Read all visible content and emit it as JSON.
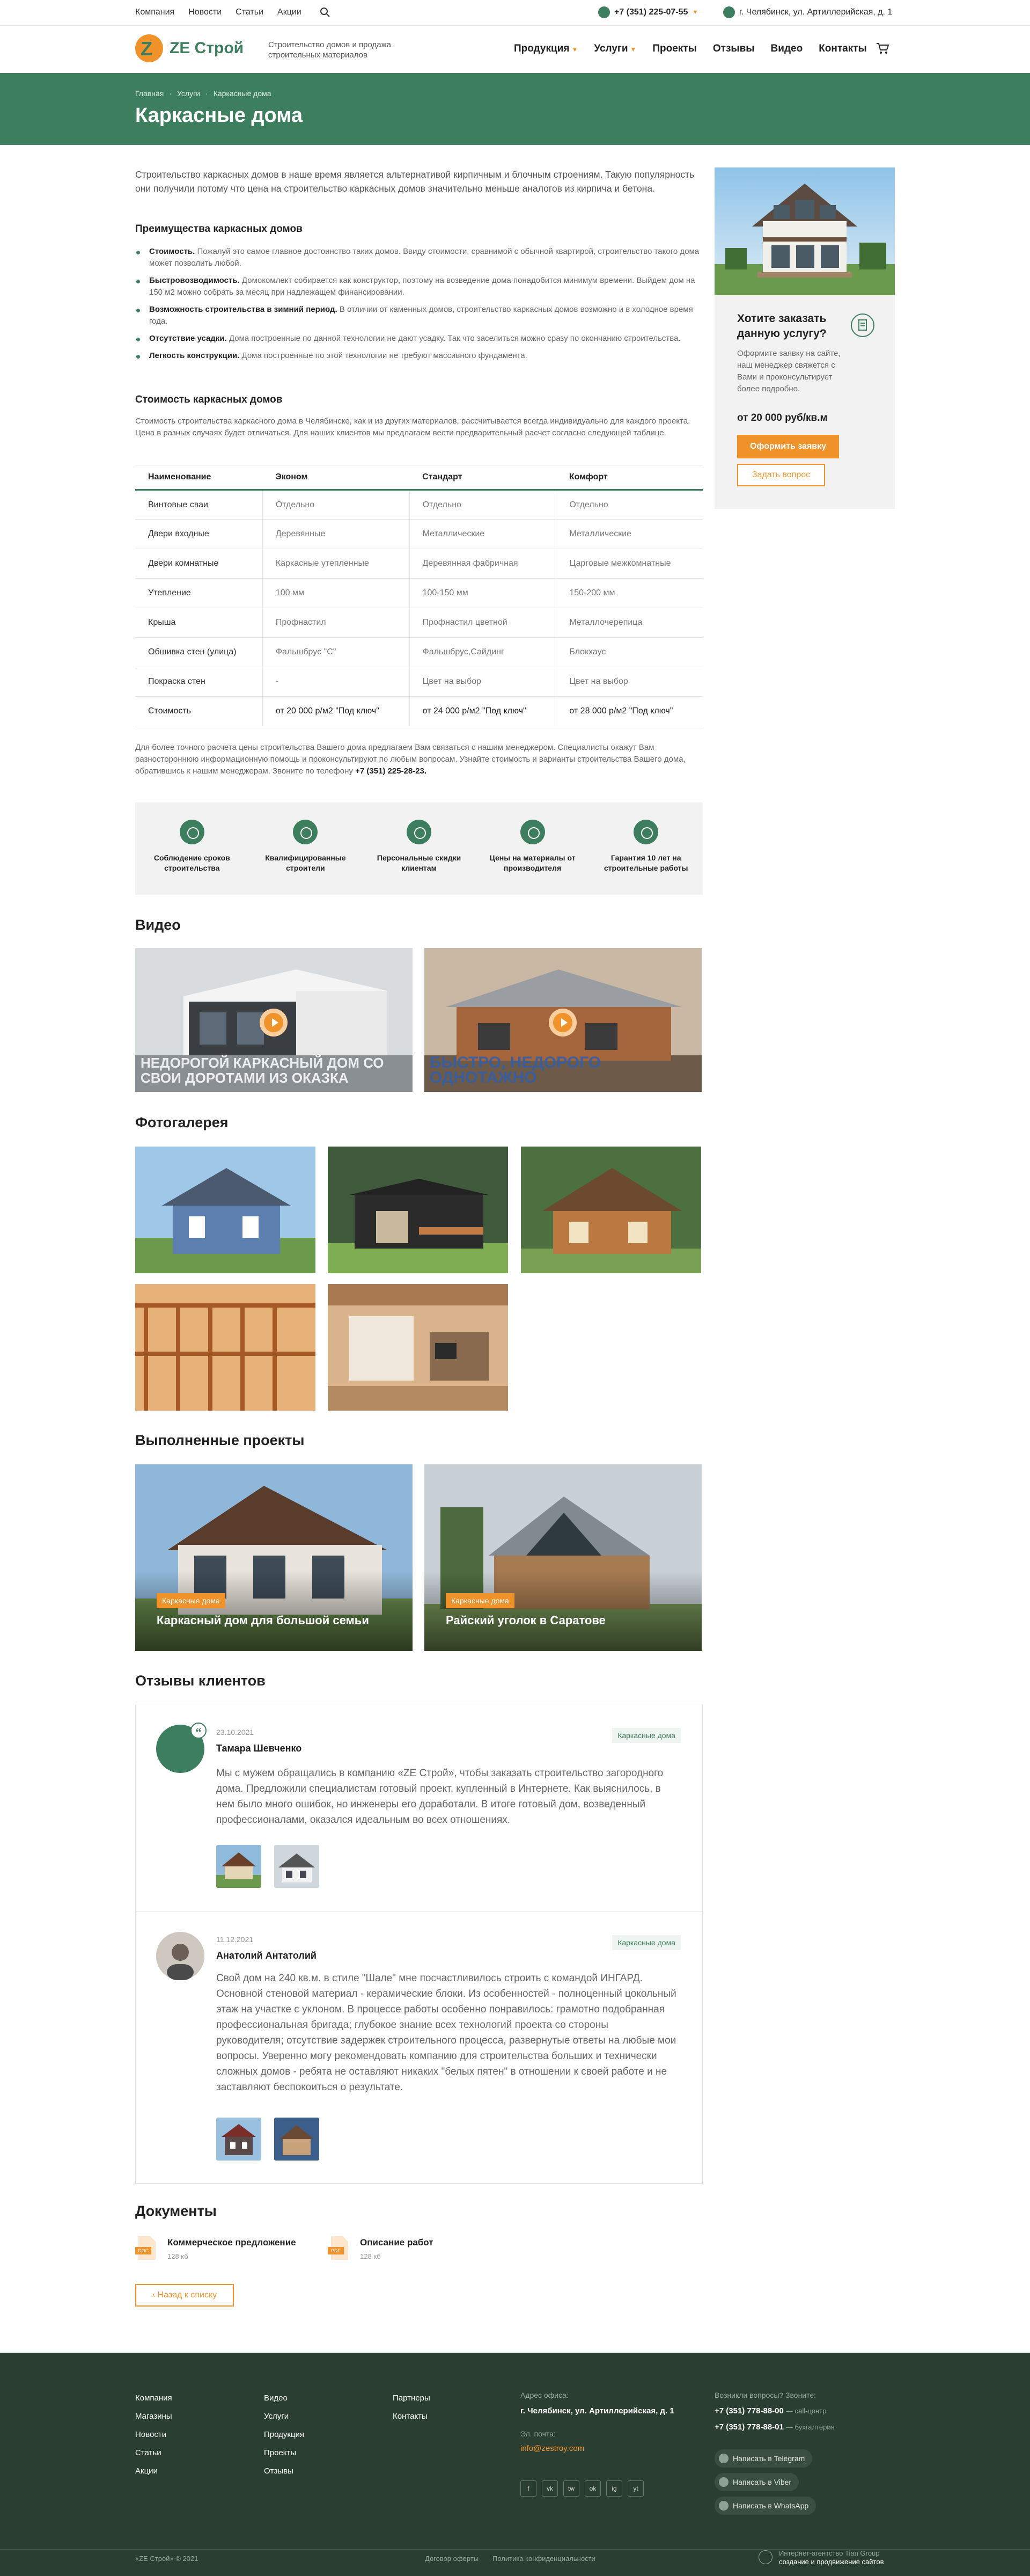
{
  "topbar": {
    "links": [
      "Компания",
      "Новости",
      "Статьи",
      "Акции"
    ],
    "phone": "+7 (351) 225-07-55",
    "address": "г. Челябинск, ул. Артиллерийская, д. 1"
  },
  "header": {
    "logo_letter": "Z",
    "logo_name": "ZE Строй",
    "tagline": "Строительство домов и продажа строительных материалов",
    "nav": [
      {
        "label": "Продукция",
        "dropdown": true
      },
      {
        "label": "Услуги",
        "dropdown": true
      },
      {
        "label": "Проекты",
        "dropdown": false
      },
      {
        "label": "Отзывы",
        "dropdown": false
      },
      {
        "label": "Видео",
        "dropdown": false
      },
      {
        "label": "Контакты",
        "dropdown": false
      }
    ]
  },
  "hero": {
    "breadcrumbs": [
      "Главная",
      "Услуги",
      "Каркасные дома"
    ],
    "title": "Каркасные дома"
  },
  "intro": "Строительство каркасных домов в наше время является альтернативой кирпичным и блочным строениям. Такую популярность они получили потому что цена на строительство каркасных домов значительно меньше аналогов из кирпича и бетона.",
  "advantages": {
    "title": "Преимущества каркасных домов",
    "items": [
      {
        "bold": "Стоимость.",
        "text": " Пожалуй это самое главное достоинство таких домов. Ввиду стоимости, сравнимой с обычной квартирой, строительство такого дома может позволить любой."
      },
      {
        "bold": "Быстровозводимость.",
        "text": " Домокомлект собирается как конструктор, поэтому на возведение дома понадобится минимум времени. Выйдем дом на 150 м2 можно собрать за месяц при надлежащем финансировании."
      },
      {
        "bold": "Возможность строительства в зимний период.",
        "text": " В отличии от каменных домов, строительство каркасных домов возможно и в холодное время года."
      },
      {
        "bold": "Отсутствие усадки.",
        "text": " Дома построенные по данной технологии не дают усадку. Так что заселиться можно сразу по окончанию строительства."
      },
      {
        "bold": "Легкость конструкции.",
        "text": " Дома построенные по этой технологии не требуют массивного фундамента."
      }
    ]
  },
  "cost": {
    "title": "Стоимость каркасных домов",
    "text": "Стоимость строительства каркасного дома в Челябинске, как и из других материалов, рассчитывается всегда индивидуально для каждого проекта. Цена в разных случаях будет отличаться. Для наших клиентов мы предлагаем вести предварительный расчет согласно следующей таблице."
  },
  "table": {
    "headers": [
      "Наименование",
      "Эконом",
      "Стандарт",
      "Комфорт"
    ],
    "rows": [
      [
        "Винтовые сваи",
        "Отдельно",
        "Отдельно",
        "Отдельно"
      ],
      [
        "Двери входные",
        "Деревянные",
        "Металлические",
        "Металлические"
      ],
      [
        "Двери комнатные",
        "Каркасные утепленные",
        "Деревянная фабричная",
        "Царговые межкомнатные"
      ],
      [
        "Утепление",
        "100 мм",
        "100-150 мм",
        "150-200 мм"
      ],
      [
        "Крыша",
        "Профнастил",
        "Профнастил цветной",
        "Металлочерепица"
      ],
      [
        "Обшивка стен (улица)",
        "Фальшбрус \"С\"",
        "Фальшбрус,Сайдинг",
        "Блокхаус"
      ],
      [
        "Покраска стен",
        "-",
        "Цвет на выбор",
        "Цвет на выбор"
      ],
      [
        "Стоимость",
        "от 20 000 р/м2 \"Под ключ\"",
        "от 24 000 р/м2 \"Под ключ\"",
        "от 28 000 р/м2 \"Под ключ\""
      ]
    ]
  },
  "table_note": "Для более точного расчета цены строительства Вашего дома предлагаем Вам связаться с нашим менеджером. Специалисты окажут Вам разностороннюю информационную помощь и проконсультируют по любым вопросам. Узнайте стоимость и варианты строительства Вашего дома, обратившись к нашим менеджерам. Звоните по телефону",
  "table_note_phone": "+7 (351) 225-28-23.",
  "aside": {
    "title": "Хотите заказать данную услугу?",
    "desc": "Оформите заявку на сайте, наш менеджер свяжется с Вами и проконсультирует более подробно.",
    "price": "от 20 000 руб/кв.м",
    "order_label": "Оформить заявку",
    "ask_label": "Задать вопрос"
  },
  "features": [
    "Соблюдение сроков строительства",
    "Квалифицированные строители",
    "Персональные скидки клиентам",
    "Цены на материалы от производителя",
    "Гарантия 10 лет на строительные работы"
  ],
  "videos": {
    "title": "Видео",
    "items": [
      {
        "caption": "Недорогой каркасный дом со свои доротами из оказка"
      },
      {
        "caption": "Быстро, недорого однотажно"
      }
    ]
  },
  "gallery": {
    "title": "Фотогалерея"
  },
  "projects": {
    "title": "Выполненные проекты",
    "items": [
      {
        "badge": "Каркасные дома",
        "title": "Каркасный дом для большой семьи"
      },
      {
        "badge": "Каркасные дома",
        "title": "Райский уголок в Саратове"
      }
    ]
  },
  "reviews": {
    "title": "Отзывы клиентов",
    "items": [
      {
        "date": "23.10.2021",
        "name": "Тамара Шевченко",
        "tag": "Каркасные дома",
        "text": "Мы с мужем обращались в компанию «ZE Строй», чтобы заказать строительство загородного дома. Предложили специалистам готовый проект, купленный в Интернете. Как выяснилось, в нем было много ошибок, но инженеры его доработали. В итоге готовый дом, возведенный профессионалами, оказался идеальным во всех отношениях."
      },
      {
        "date": "11.12.2021",
        "name": "Анатолий Антатолий",
        "tag": "Каркасные дома",
        "text": "Свой дом на 240 кв.м. в стиле \"Шале\" мне посчастливилось строить с командой ИНГАРД. Основной стеновой материал - керамические блоки. Из особенностей - полноценный цокольный этаж на участке с уклоном. В процессе работы особенно понравилось: грамотно подобранная профессиональная бригада; глубокое знание всех технологий проекта со стороны руководителя; отсутствие задержек строительного процесса, развернутые ответы на любые мои вопросы. Уверенно могу рекомендовать компанию для строительства больших и технически сложных домов - ребята не оставляют никаких \"белых пятен\" в отношении к своей работе и не заставляют беспокоиться о результате."
      }
    ]
  },
  "documents": {
    "title": "Документы",
    "items": [
      {
        "title": "Коммерческое предложение",
        "size": "128 кб",
        "ext": "DOC"
      },
      {
        "title": "Описание работ",
        "size": "128 кб",
        "ext": "PDF"
      }
    ],
    "back_label": "Назад к списку"
  },
  "footer": {
    "col1": [
      "Компания",
      "Магазины",
      "Новости",
      "Статьи",
      "Акции"
    ],
    "col2": [
      "Видео",
      "Услуги",
      "Продукция",
      "Проекты",
      "Отзывы"
    ],
    "col3": [
      "Партнеры",
      "Контакты"
    ],
    "address_label": "Адрес офиса:",
    "address": "г. Челябинск, ул. Артиллерийская, д. 1",
    "email_label": "Эл. почта:",
    "email": "info@zestroy.com",
    "questions_label": "Возникли вопросы? Звоните:",
    "phone1": "+7 (351) 778-88-00",
    "phone1_note": "— call-центр",
    "phone2": "+7 (351) 778-88-01",
    "phone2_note": "— бухгалтерия",
    "messengers": [
      "Написать в Telegram",
      "Написать в Viber",
      "Написать в WhatsApp"
    ],
    "social": [
      "f",
      "vk",
      "tw",
      "ok",
      "ig",
      "yt"
    ],
    "copyright": "«ZE Строй» © 2021",
    "offer": "Договор оферты",
    "privacy": "Политика конфиденциальности",
    "agency_line1": "Интернет-агентство Tian Group",
    "agency_line2": "создание и продвижение сайтов"
  },
  "colors": {
    "accent": "#3d7e5e",
    "orange": "#f0932b",
    "footer_bg": "#2b3e32"
  }
}
